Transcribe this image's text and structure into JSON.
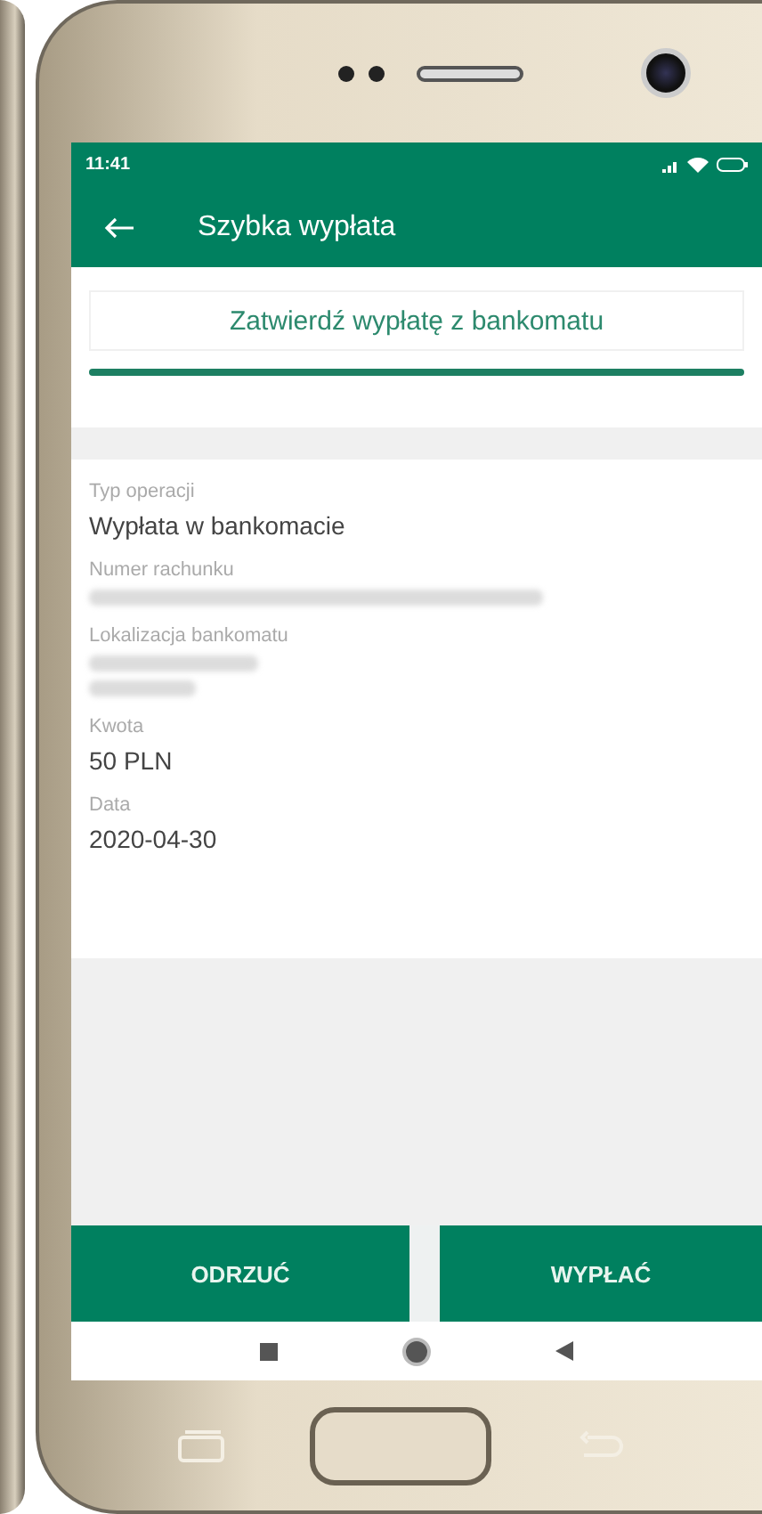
{
  "status_bar": {
    "time": "11:41"
  },
  "app_bar": {
    "title": "Szybka wypłata"
  },
  "confirm_header": {
    "title": "Zatwierdź wypłatę z bankomatu"
  },
  "details": [
    {
      "kind": "text",
      "label": "Typ operacji",
      "value": "Wypłata w bankomacie"
    },
    {
      "kind": "redacted",
      "label": "Numer rachunku"
    },
    {
      "kind": "redacted-address",
      "label": "Lokalizacja bankomatu"
    },
    {
      "kind": "text",
      "label": "Kwota",
      "value": "50 PLN"
    },
    {
      "kind": "text",
      "label": "Data",
      "value": "2020-04-30"
    }
  ],
  "buttons": [
    {
      "label": "ODRZUĆ"
    },
    {
      "label": "WYPŁAĆ"
    }
  ]
}
